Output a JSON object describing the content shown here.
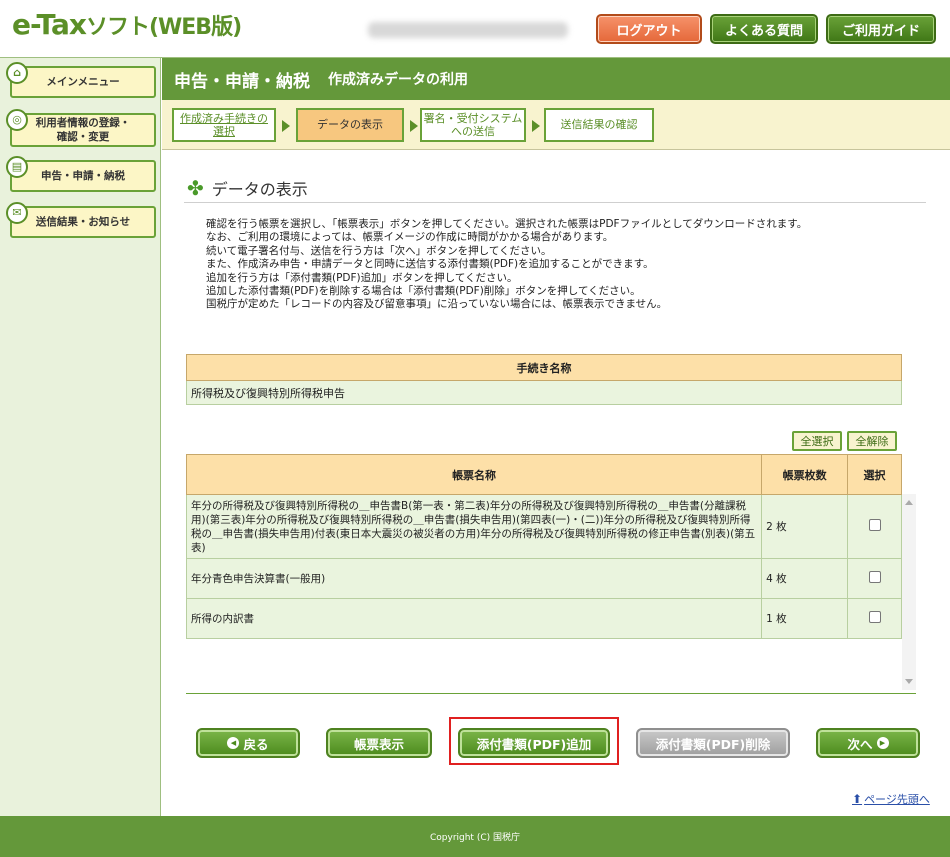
{
  "header": {
    "logo_main": "e-Tax",
    "logo_sub": "ソフト(WEB版)",
    "logout": "ログアウト",
    "faq": "よくある質問",
    "guide": "ご利用ガイド"
  },
  "sidebar": {
    "items": [
      {
        "label": "メインメニュー"
      },
      {
        "label": "利用者情報の登録・\n確認・変更"
      },
      {
        "label": "申告・申請・納税"
      },
      {
        "label": "送信結果・お知らせ"
      }
    ]
  },
  "main": {
    "title": "申告・申請・納税",
    "subtitle": "作成済みデータの利用",
    "steps": [
      {
        "label": "作成済み手続きの\n選択"
      },
      {
        "label": "データの表示"
      },
      {
        "label": "署名・受付システム\nへの送信"
      },
      {
        "label": "送信結果の確認"
      }
    ],
    "section_title": "データの表示",
    "instructions": [
      "確認を行う帳票を選択し、「帳票表示」ボタンを押してください。選択された帳票はPDFファイルとしてダウンロードされます。",
      "なお、ご利用の環境によっては、帳票イメージの作成に時間がかかる場合があります。",
      "続いて電子署名付与、送信を行う方は「次へ」ボタンを押してください。",
      "また、作成済み申告・申請データと同時に送信する添付書類(PDF)を追加することができます。",
      "追加を行う方は「添付書類(PDF)追加」ボタンを押してください。",
      "追加した添付書類(PDF)を削除する場合は「添付書類(PDF)削除」ボタンを押してください。",
      "国税庁が定めた「レコードの内容及び留意事項」に沿っていない場合には、帳票表示できません。"
    ],
    "proc_table": {
      "header": "手続き名称",
      "value": "所得税及び復興特別所得税申告"
    },
    "select_all": "全選択",
    "deselect_all": "全解除",
    "forms_table": {
      "headers": [
        "帳票名称",
        "帳票枚数",
        "選択"
      ],
      "rows": [
        {
          "name": "年分の所得税及び復興特別所得税の＿申告書B(第一表・第二表)年分の所得税及び復興特別所得税の＿申告書(分離課税用)(第三表)年分の所得税及び復興特別所得税の＿申告書(損失申告用)(第四表(一)・(二))年分の所得税及び復興特別所得税の＿申告書(損失申告用)付表(東日本大震災の被災者の方用)年分の所得税及び復興特別所得税の修正申告書(別表)(第五表)",
          "count": "2 枚"
        },
        {
          "name": "年分青色申告決算書(一般用)",
          "count": "4 枚"
        },
        {
          "name": "所得の内訳書",
          "count": "1 枚"
        }
      ]
    },
    "buttons": {
      "back": "戻る",
      "view": "帳票表示",
      "add_pdf": "添付書類(PDF)追加",
      "delete_pdf": "添付書類(PDF)削除",
      "next": "次へ"
    },
    "page_top": "ページ先頭へ"
  },
  "footer": {
    "copyright": "Copyright (C) 国税庁"
  },
  "colors": {
    "brand_green": "#64983a",
    "highlight_red": "#e02020",
    "logout_orange": "#e5683a"
  }
}
